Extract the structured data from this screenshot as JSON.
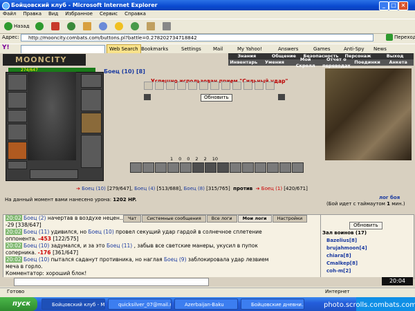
{
  "window": {
    "title": "Бойцовский клуб - Microsoft Internet Explorer"
  },
  "menu": [
    "Файл",
    "Правка",
    "Вид",
    "Избранное",
    "Сервис",
    "Справка"
  ],
  "toolbar": {
    "back": "Назад"
  },
  "address": {
    "label": "Адрес:",
    "url": "http://mooncity.combats.com/buttons.pl?battle=0.278202734718842",
    "go": "Переход"
  },
  "yahoo": {
    "search": "Web Search",
    "bookmarks": "Bookmarks",
    "settings": "Settings",
    "mail": "Mail",
    "myyahoo": "My Yahoo!",
    "answers": "Answers",
    "games": "Games",
    "antispy": "Anti-Spy",
    "news": "News"
  },
  "game": {
    "logo": "MOONCITY",
    "nav1": [
      "Знания",
      "Общение",
      "Безопасность",
      "Персонаж",
      "Выход"
    ],
    "nav2": [
      "Инвентарь",
      "Умения",
      "Мой Скролл",
      "Отчет о переводах",
      "Поединки",
      "Анкета"
    ],
    "hp": "274/647",
    "fighter": "Боец (10) [8]",
    "message": "Успешно использован прием \"Сильный удар\"",
    "refresh": "Обновить",
    "counters": [
      "1",
      "0",
      "0",
      "2",
      "2",
      "10"
    ],
    "teams": {
      "left": [
        {
          "name": "Боец (10)",
          "hp": "[279/647]"
        },
        {
          "name": "Боец (4)",
          "hp": "[513/688]"
        },
        {
          "name": "Боец (8)",
          "hp": "[315/765]"
        }
      ],
      "versus": "против",
      "right": [
        {
          "name": "Боец (1)",
          "hp": "[420/671]"
        }
      ]
    },
    "log_link": "лог боя",
    "damage_text": "На данный момент вами нанесено урона:",
    "damage_value": "1202 HP.",
    "timeout_text": "(Бой идет с таймаутом",
    "timeout_value": "1",
    "timeout_unit": "мин.)"
  },
  "tabs": [
    "Чат",
    "Системные сообщения",
    "Все логи",
    "Мои логи",
    "Настройки"
  ],
  "chat": [
    {
      "ts": "20:02",
      "html": [
        [
          "nm-b",
          "Боец (2)"
        ],
        [
          "",
          "начертав в воздухе нецен..."
        ]
      ]
    },
    {
      "ts": "",
      "html": [
        [
          "",
          "-29 [338/647]"
        ]
      ]
    },
    {
      "ts": "20:02",
      "html": [
        [
          "nm-b",
          "Боец (11)"
        ],
        [
          "",
          "удивился, но "
        ],
        [
          "nm-b",
          "Боец (10)"
        ],
        [
          "",
          "провел секущий удар гардой в солнечное сплетение"
        ]
      ]
    },
    {
      "ts": "",
      "html": [
        [
          "",
          "оппонента. "
        ],
        [
          "dmg-r",
          "-453"
        ],
        [
          "",
          "[122/575]"
        ]
      ]
    },
    {
      "ts": "20:02",
      "html": [
        [
          "nm-b",
          "Боец (10)"
        ],
        [
          "",
          "задумался, и за это "
        ],
        [
          "nm-b",
          "Боец (11)"
        ],
        [
          "",
          ", забыв все светские манеры, укусил в пупок"
        ]
      ]
    },
    {
      "ts": "",
      "html": [
        [
          "",
          "соперника. "
        ],
        [
          "dmg-r",
          "-176"
        ],
        [
          "",
          "[361/647]"
        ]
      ]
    },
    {
      "ts": "20:02",
      "html": [
        [
          "nm-b",
          "Боец (10)"
        ],
        [
          "",
          "пытался саданут противника, но наглая "
        ],
        [
          "nm-b",
          "Боец (9)"
        ],
        [
          "",
          "заблокировала удар лезвием"
        ]
      ]
    },
    {
      "ts": "",
      "html": [
        [
          "",
          "меча в горло."
        ]
      ]
    },
    {
      "ts": "",
      "html": [
        [
          "",
          "Комментатор: хороший блок!"
        ]
      ]
    }
  ],
  "side": {
    "refresh": "Обновить",
    "warriors_title": "Зал воинов (17)",
    "warriors": [
      "Bazelius[8]",
      "brujahmoon[4]",
      "chiara[8]",
      "Cmalkep[8]",
      "coh-m[2]"
    ]
  },
  "clock": "20:04",
  "status": {
    "left": "Готово",
    "right": "Интернет"
  },
  "taskbar": {
    "start": "пуск",
    "tasks": [
      "Бойцовский клуб - M...",
      "quicksilver_07@mail.r...",
      "Azerbaijan-Baku",
      "Бойцовские дневни..."
    ]
  },
  "watermark": "photo.scrolls.combats.com"
}
